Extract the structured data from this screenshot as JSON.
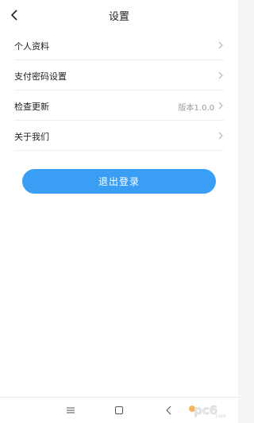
{
  "header": {
    "title": "设置"
  },
  "settings": [
    {
      "label": "个人资料",
      "value": ""
    },
    {
      "label": "支付密码设置",
      "value": ""
    },
    {
      "label": "检查更新",
      "value": "版本1.0.0"
    },
    {
      "label": "关于我们",
      "value": ""
    }
  ],
  "logout_label": "退出登录",
  "watermark": {
    "text": "pc6",
    "suffix": ".com"
  },
  "colors": {
    "accent": "#3a9ef5",
    "background": "#f5f5f5"
  },
  "icons": {
    "back": "back-arrow-icon",
    "chevron": "chevron-right-icon",
    "menu": "menu-icon",
    "home": "home-square-icon",
    "back_nav": "back-triangle-icon"
  }
}
